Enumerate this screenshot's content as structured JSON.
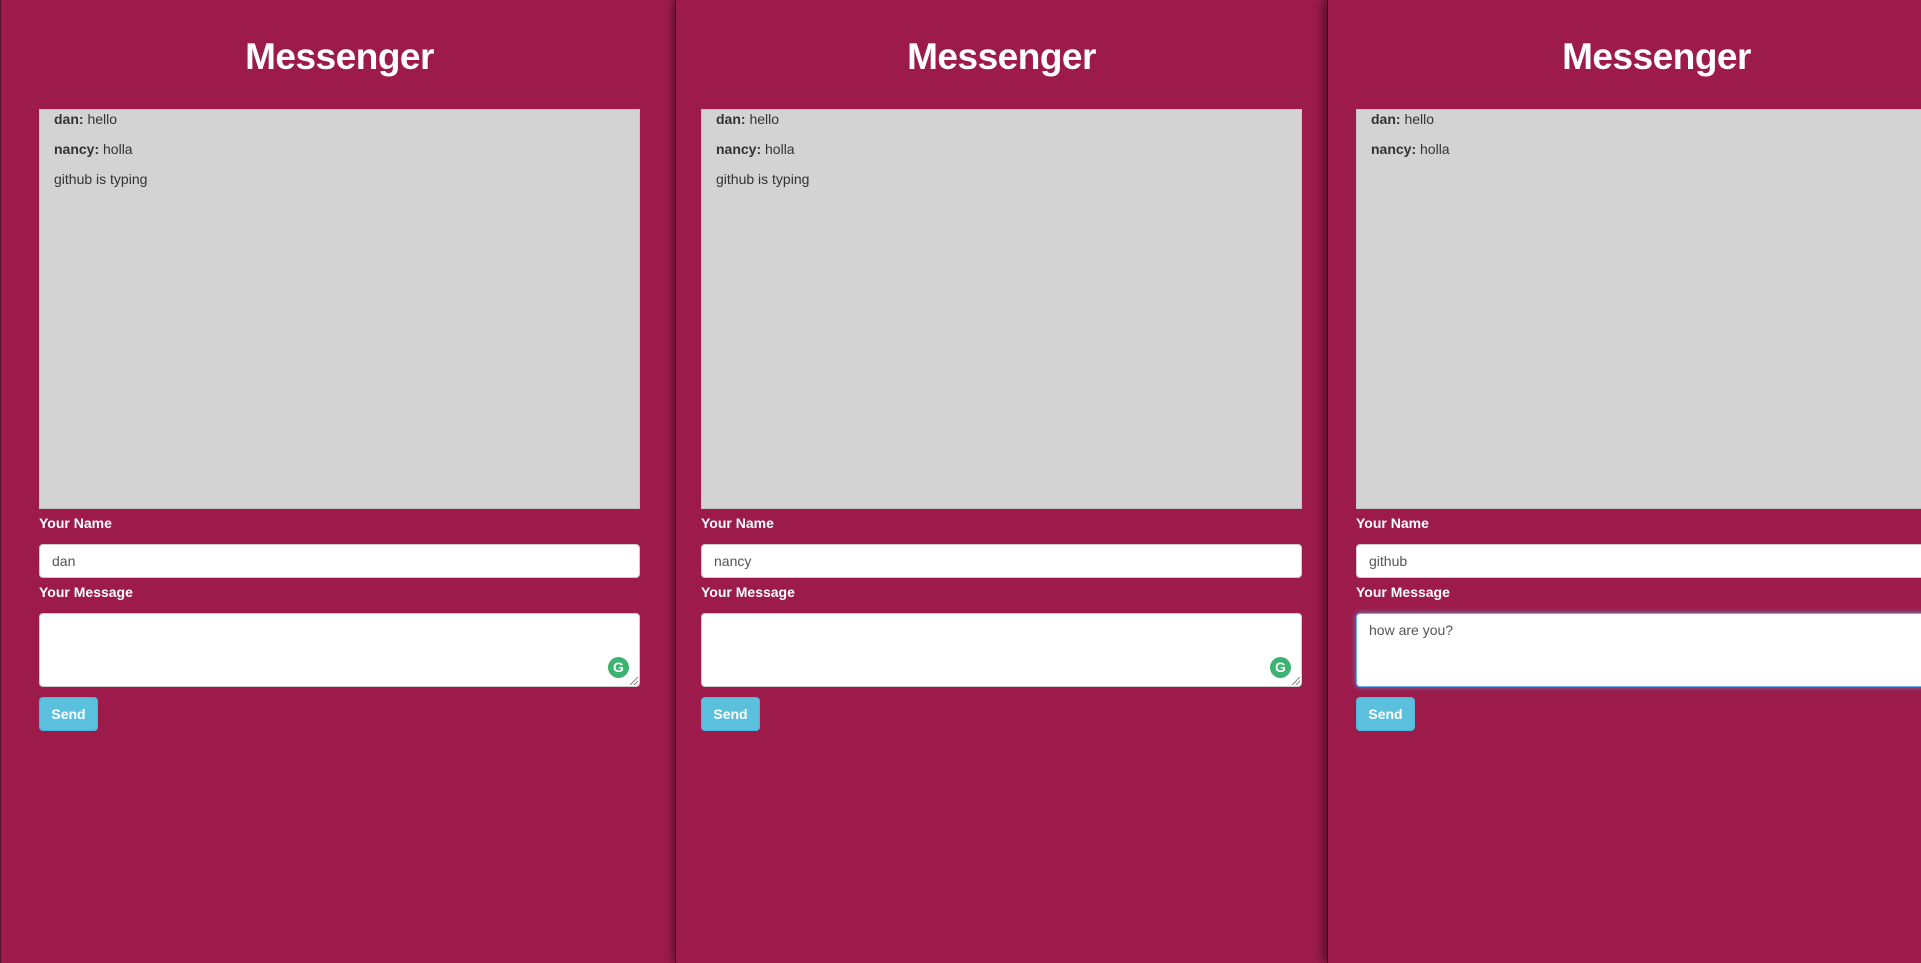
{
  "colors": {
    "background": "#9c1b4b",
    "message_panel": "#d3d3d3",
    "send_button": "#5bc0de",
    "grammarly": "#3cb371"
  },
  "windows": [
    {
      "title": "Messenger",
      "messages": [
        {
          "author": "dan:",
          "text": "hello"
        },
        {
          "author": "nancy:",
          "text": "holla"
        }
      ],
      "typing": "github is typing",
      "name_label": "Your Name",
      "name_value": "dan",
      "message_label": "Your Message",
      "message_value": "",
      "grammarly_icon": "G",
      "send_label": "Send"
    },
    {
      "title": "Messenger",
      "messages": [
        {
          "author": "dan:",
          "text": "hello"
        },
        {
          "author": "nancy:",
          "text": "holla"
        }
      ],
      "typing": "github is typing",
      "name_label": "Your Name",
      "name_value": "nancy",
      "message_label": "Your Message",
      "message_value": "",
      "grammarly_icon": "G",
      "send_label": "Send"
    },
    {
      "title": "Messenger",
      "messages": [
        {
          "author": "dan:",
          "text": "hello"
        },
        {
          "author": "nancy:",
          "text": "holla"
        }
      ],
      "typing": "",
      "name_label": "Your Name",
      "name_value": "github",
      "message_label": "Your Message",
      "message_value": "how are you?",
      "send_label": "Send"
    }
  ]
}
